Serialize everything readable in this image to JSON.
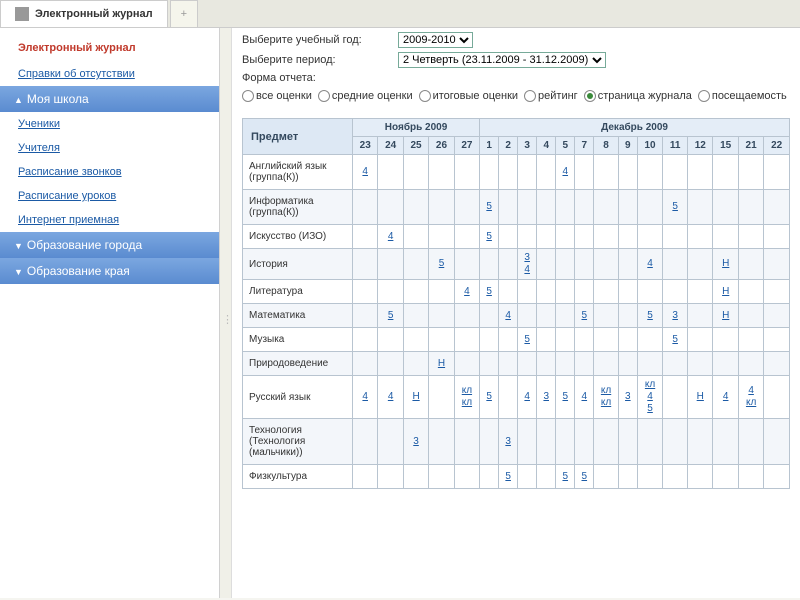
{
  "tabs": {
    "main": "Электронный журнал",
    "add": "+"
  },
  "sidebar": {
    "title": "Электронный журнал",
    "link_absence": "Справки об отсутствии",
    "section_school": "Моя школа",
    "links_school": [
      "Ученики",
      "Учителя",
      "Расписание звонков",
      "Расписание уроков",
      "Интернет приемная"
    ],
    "section_city": "Образование города",
    "section_region": "Образование края"
  },
  "filters": {
    "year_label": "Выберите учебный год:",
    "year_value": "2009-2010",
    "period_label": "Выберите период:",
    "period_value": "2 Четверть (23.11.2009 - 31.12.2009)",
    "report_label": "Форма отчета:",
    "report_options": [
      "все оценки",
      "средние оценки",
      "итоговые оценки",
      "рейтинг",
      "страница журнала",
      "посещаемость"
    ],
    "report_selected": 4
  },
  "table": {
    "subject_header": "Предмет",
    "months": [
      {
        "name": "Ноябрь 2009",
        "days": [
          "23",
          "24",
          "25",
          "26",
          "27"
        ]
      },
      {
        "name": "Декабрь 2009",
        "days": [
          "1",
          "2",
          "3",
          "4",
          "5",
          "7",
          "8",
          "9",
          "10",
          "11",
          "12",
          "15",
          "21",
          "22"
        ]
      }
    ],
    "rows": [
      {
        "subject": "Английский язык (группа(К))",
        "cells": {
          "0": "4",
          "9": "4"
        }
      },
      {
        "subject": "Информатика (группа(К))",
        "cells": {
          "5": "5",
          "14": "5"
        }
      },
      {
        "subject": "Искусство (ИЗО)",
        "cells": {
          "1": "4",
          "5": "5"
        }
      },
      {
        "subject": "История",
        "cells": {
          "3": "5",
          "7": [
            "3",
            "4"
          ],
          "13": "4",
          "16": "Н"
        }
      },
      {
        "subject": "Литература",
        "cells": {
          "4": "4",
          "5": "5",
          "16": "Н"
        }
      },
      {
        "subject": "Математика",
        "cells": {
          "1": "5",
          "6": "4",
          "10": "5",
          "13": "5",
          "14": "3",
          "16": "Н"
        }
      },
      {
        "subject": "Музыка",
        "cells": {
          "7": "5",
          "14": "5"
        }
      },
      {
        "subject": "Природоведение",
        "cells": {
          "3": "Н"
        }
      },
      {
        "subject": "Русский язык",
        "cells": {
          "0": "4",
          "1": "4",
          "2": "Н",
          "4": [
            "кл",
            "кл"
          ],
          "5": "5",
          "7": "4",
          "8": "3",
          "9": "5",
          "10": "4",
          "11": [
            "кл",
            "кл"
          ],
          "12": "3",
          "13": [
            "кл",
            "4",
            "5"
          ],
          "15": "Н",
          "16": "4",
          "17": [
            "4",
            "кл"
          ]
        }
      },
      {
        "subject": "Технология (Технология (мальчики))",
        "cells": {
          "2": "3",
          "6": "3"
        }
      },
      {
        "subject": "Физкультура",
        "cells": {
          "6": "5",
          "9": "5",
          "10": "5"
        }
      }
    ]
  }
}
